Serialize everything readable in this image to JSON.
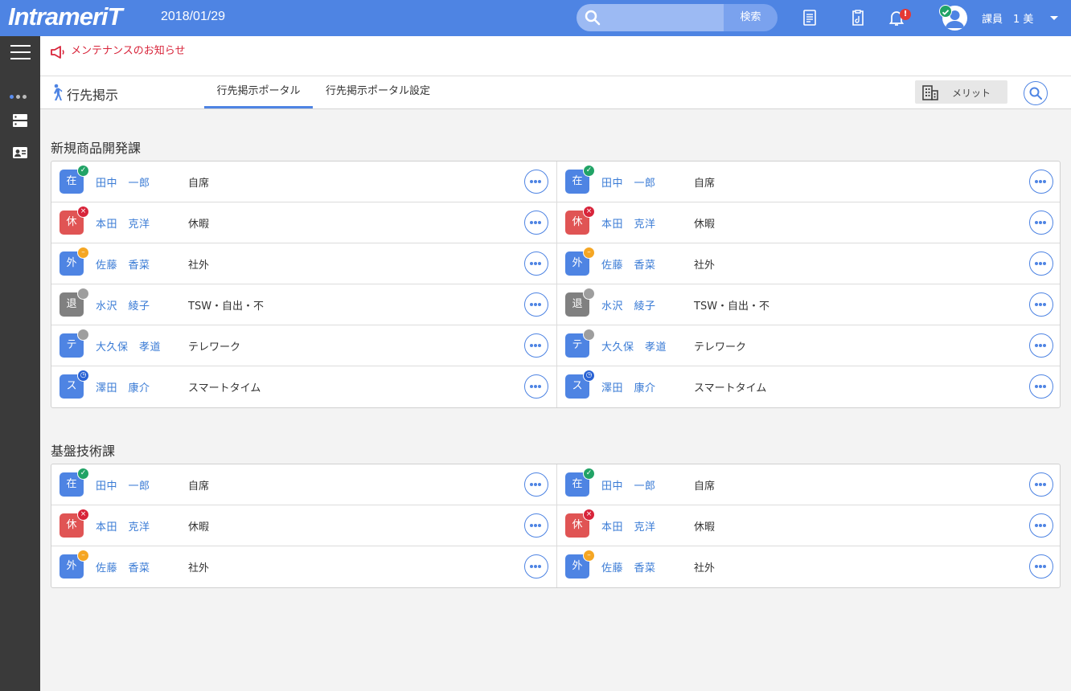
{
  "header": {
    "logo": "IntrameriT",
    "date": "2018/01/29",
    "search_placeholder": "",
    "search_button": "検索",
    "notification_badge": "!",
    "user_name": "課員　1 美"
  },
  "notice": {
    "text": "メンテナンスのお知らせ"
  },
  "subnav": {
    "title": "行先掲示",
    "tabs": [
      {
        "label": "行先掲示ポータル"
      },
      {
        "label": "行先掲示ポータル設定"
      }
    ],
    "merit_label": "メリット"
  },
  "colors": {
    "in": "#4e84e3",
    "off": "#e05454",
    "out": "#4e84e3",
    "left": "#808080",
    "tele": "#4e84e3",
    "smart": "#4e84e3",
    "check": "#21a366",
    "cross": "#d8243a",
    "dash": "#f5a623",
    "gray": "#9e9e9e",
    "clock": "#2962d4"
  },
  "groups": [
    {
      "title": "新規商品開発課",
      "rows": [
        {
          "badge": "在",
          "name": "田中　一郎",
          "status": "自席"
        },
        {
          "badge": "休",
          "name": "本田　克洋",
          "status": "休暇"
        },
        {
          "badge": "外",
          "name": "佐藤　香菜",
          "status": "社外"
        },
        {
          "badge": "退",
          "name": "水沢　綾子",
          "status": "TSW・自出・不"
        },
        {
          "badge": "テ",
          "name": "大久保　孝道",
          "status": "テレワーク"
        },
        {
          "badge": "ス",
          "name": "澤田　康介",
          "status": "スマートタイム"
        }
      ]
    },
    {
      "title": "基盤技術課",
      "rows": [
        {
          "badge": "在",
          "name": "田中　一郎",
          "status": "自席"
        },
        {
          "badge": "休",
          "name": "本田　克洋",
          "status": "休暇"
        },
        {
          "badge": "外",
          "name": "佐藤　香菜",
          "status": "社外"
        }
      ]
    }
  ]
}
